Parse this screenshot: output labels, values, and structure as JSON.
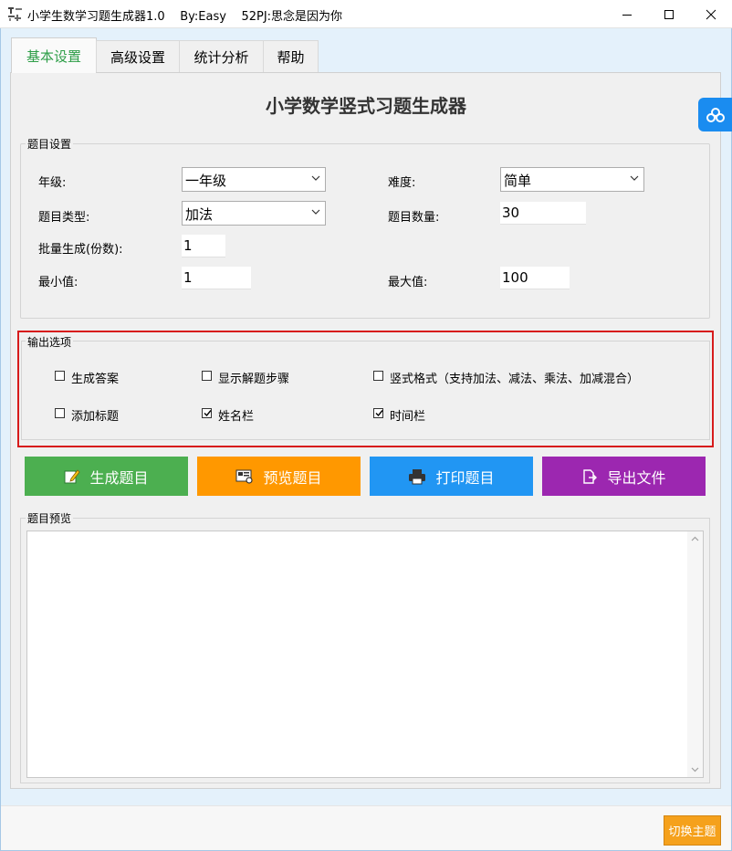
{
  "window": {
    "title": "小学生数学习题生成器1.0",
    "author": "By:Easy",
    "tagline": "52PJ:思念是因为你"
  },
  "tabs": [
    {
      "label": "基本设置",
      "active": true
    },
    {
      "label": "高级设置",
      "active": false
    },
    {
      "label": "统计分析",
      "active": false
    },
    {
      "label": "帮助",
      "active": false
    }
  ],
  "main_title": "小学数学竖式习题生成器",
  "question_settings": {
    "group_label": "题目设置",
    "grade_label": "年级:",
    "grade_value": "一年级",
    "difficulty_label": "难度:",
    "difficulty_value": "简单",
    "type_label": "题目类型:",
    "type_value": "加法",
    "count_label": "题目数量:",
    "count_value": "30",
    "batch_label": "批量生成(份数):",
    "batch_value": "1",
    "min_label": "最小值:",
    "min_value": "1",
    "max_label": "最大值:",
    "max_value": "100"
  },
  "output_options": {
    "group_label": "输出选项",
    "generate_answer": {
      "label": "生成答案",
      "checked": false
    },
    "show_steps": {
      "label": "显示解题步骤",
      "checked": false
    },
    "vertical_format": {
      "label": "竖式格式（支持加法、减法、乘法、加减混合）",
      "checked": false
    },
    "add_title": {
      "label": "添加标题",
      "checked": false
    },
    "name_field": {
      "label": "姓名栏",
      "checked": true
    },
    "time_field": {
      "label": "时间栏",
      "checked": true
    }
  },
  "actions": {
    "generate": "生成题目",
    "preview": "预览题目",
    "print": "打印题目",
    "export": "导出文件"
  },
  "preview": {
    "group_label": "题目预览",
    "content": ""
  },
  "theme_button": "切换主题",
  "colors": {
    "generate": "#4caf50",
    "preview": "#ff9800",
    "print": "#2196f3",
    "export": "#9c27b0",
    "active_tab": "#2e9e48",
    "highlight_border": "#d71b1b",
    "theme_button": "#f5a11c"
  }
}
